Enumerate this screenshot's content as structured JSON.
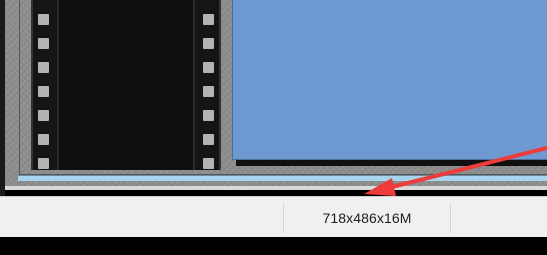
{
  "status_bar": {
    "image_size": "718x486x16M"
  },
  "colors": {
    "preview_fill": "#6e9ad1",
    "film_strip": "#151515",
    "annotation_arrow": "#ee3b3b",
    "canvas_background": "#8d8d8d",
    "status_bar_background": "#f0f0f0"
  },
  "icons": {
    "annotation": "red-arrow-icon"
  }
}
